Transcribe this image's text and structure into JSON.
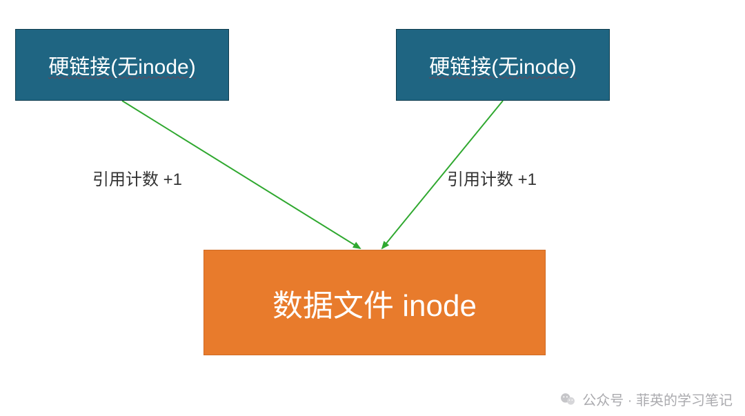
{
  "nodes": {
    "hardlink1": {
      "label": "硬链接(无inode)"
    },
    "hardlink2": {
      "label": "硬链接(无inode)"
    },
    "datafile": {
      "label": "数据文件 inode"
    }
  },
  "edges": {
    "left": {
      "label": "引用计数 +1"
    },
    "right": {
      "label": "引用计数 +1"
    }
  },
  "watermark": {
    "text": "公众号 · 菲英的学习笔记"
  },
  "colors": {
    "hardlinkFill": "#1f6582",
    "datafileFill": "#e87b2c",
    "arrowStroke": "#2fa82f"
  },
  "chart_data": {
    "type": "diagram",
    "nodes": [
      {
        "id": "hardlink-1",
        "label": "硬链接(无inode)",
        "kind": "hardlink"
      },
      {
        "id": "hardlink-2",
        "label": "硬链接(无inode)",
        "kind": "hardlink"
      },
      {
        "id": "datafile",
        "label": "数据文件 inode",
        "kind": "inode"
      }
    ],
    "edges": [
      {
        "from": "hardlink-1",
        "to": "datafile",
        "label": "引用计数 +1"
      },
      {
        "from": "hardlink-2",
        "to": "datafile",
        "label": "引用计数 +1"
      }
    ]
  }
}
